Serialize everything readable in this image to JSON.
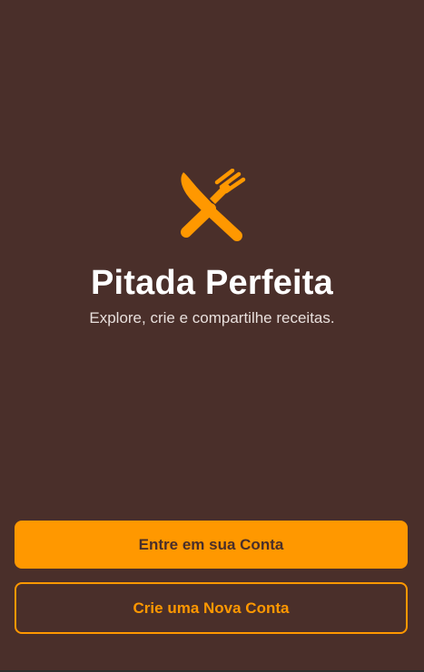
{
  "app": {
    "title": "Pitada Perfeita",
    "subtitle": "Explore, crie e compartilhe receitas.",
    "logo_icon": "utensils-crossed-icon"
  },
  "actions": {
    "login_label": "Entre em sua Conta",
    "signup_label": "Crie uma Nova Conta"
  },
  "colors": {
    "background": "#4a2f2a",
    "accent": "#ff9800",
    "title_text": "#ffffff",
    "subtitle_text": "#e8dfdc"
  }
}
